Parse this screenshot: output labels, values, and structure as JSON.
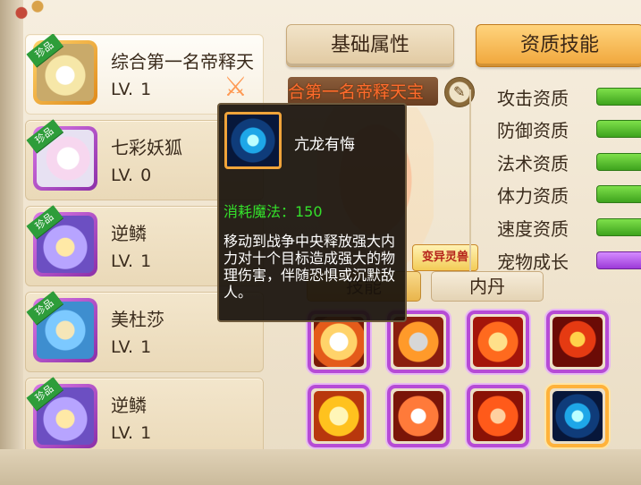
{
  "tabs": {
    "basic": "基础属性",
    "skill": "资质技能"
  },
  "pets": [
    {
      "name": "综合第一名帝释天",
      "badge": "珍品",
      "level_prefix": "LV.",
      "level": "1"
    },
    {
      "name": "七彩妖狐",
      "badge": "珍品",
      "level_prefix": "LV.",
      "level": "0"
    },
    {
      "name": "逆鳞",
      "badge": "珍品",
      "level_prefix": "LV.",
      "level": "1"
    },
    {
      "name": "美杜莎",
      "badge": "珍品",
      "level_prefix": "LV.",
      "level": "1"
    },
    {
      "name": "逆鳞",
      "badge": "珍品",
      "level_prefix": "LV.",
      "level": "1"
    }
  ],
  "current_pet_title": "合第一名帝释天宝",
  "variant_tag": "变异灵兽",
  "attributes": [
    {
      "label": "攻击资质",
      "bar": "green"
    },
    {
      "label": "防御资质",
      "bar": "green"
    },
    {
      "label": "法术资质",
      "bar": "green"
    },
    {
      "label": "体力资质",
      "bar": "green"
    },
    {
      "label": "速度资质",
      "bar": "green"
    },
    {
      "label": "宠物成长",
      "bar": "purple"
    }
  ],
  "subtabs": {
    "skill": "技能",
    "dan": "内丹"
  },
  "skills": [
    {
      "icon": "rabbit-flame-icon"
    },
    {
      "icon": "fist-flame-icon"
    },
    {
      "icon": "phoenix-flame-icon"
    },
    {
      "icon": "demon-face-icon"
    },
    {
      "icon": "golden-shield-icon"
    },
    {
      "icon": "sword-slash-icon"
    },
    {
      "icon": "fireball-icon"
    },
    {
      "icon": "dragon-gear-icon"
    }
  ],
  "tooltip": {
    "name": "亢龙有悔",
    "cost": "消耗魔法：150",
    "description": "移动到战争中央释放强大内力对十个目标造成强大的物理伤害，伴随恐惧或沉默敌人。"
  },
  "colors": {
    "accent": "#f0a63a",
    "cost_text": "#34e12b",
    "skill_border": "#b64bd6"
  }
}
